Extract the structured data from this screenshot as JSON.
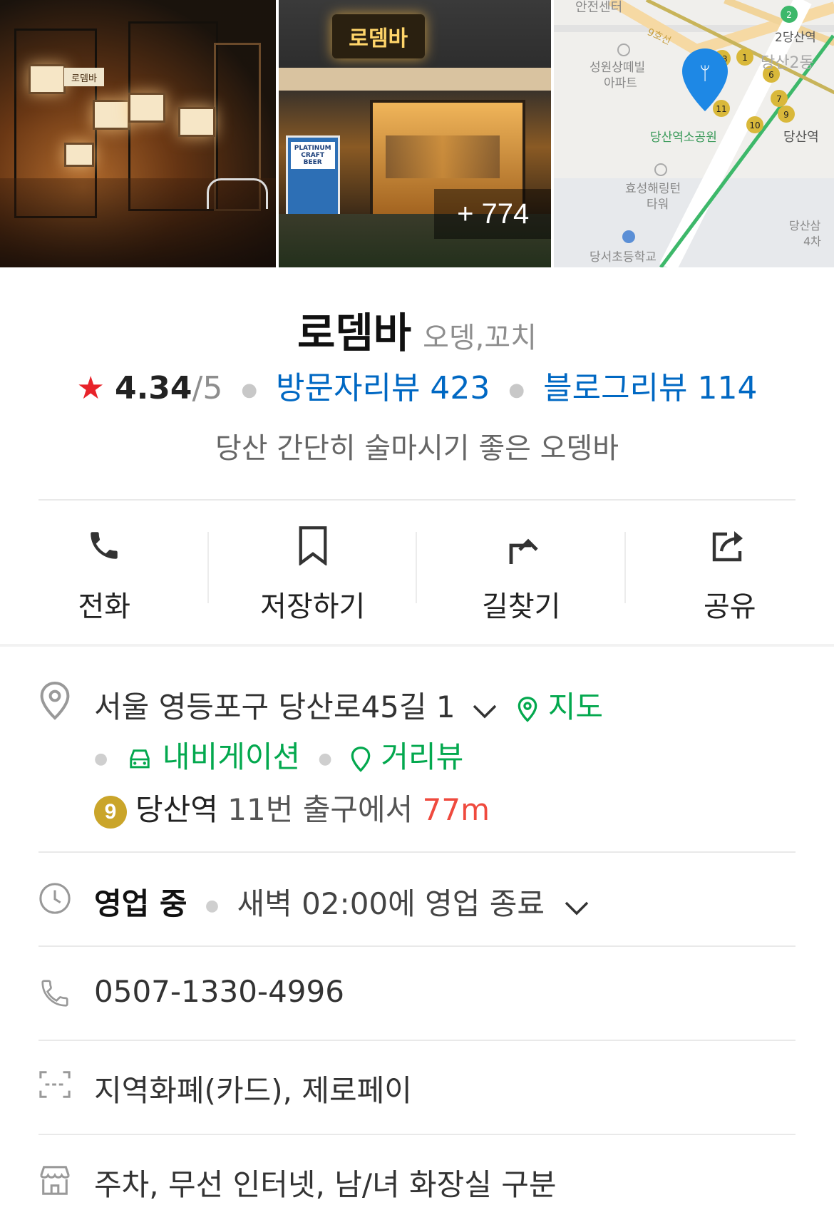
{
  "photos": {
    "photo1_sign": "로뎀바",
    "photo2_sign": "로뎀바",
    "photo2_banner": "PLATINUM CRAFT BEER",
    "more_count": "+ 774",
    "map": {
      "labels": {
        "safety_center": "안전센터",
        "line": "9호선",
        "apartment": "성원상떼빌\n아파트",
        "station_a": "2당산역",
        "dong": "당산2동",
        "station_b": "당산역",
        "park": "당산역소공원",
        "tower": "효성해링턴\n타워",
        "school": "당서초등학교",
        "road": "당산삼\n4차"
      }
    }
  },
  "place": {
    "name": "로뎀바",
    "category": "오뎅,꼬치",
    "rating": "4.34",
    "rating_max": "/5",
    "visitor_reviews": "방문자리뷰 423",
    "blog_reviews": "블로그리뷰 114",
    "description": "당산 간단히 술마시기 좋은 오뎅바"
  },
  "actions": [
    {
      "label": "전화",
      "icon": "phone-icon"
    },
    {
      "label": "저장하기",
      "icon": "bookmark-icon"
    },
    {
      "label": "길찾기",
      "icon": "directions-icon"
    },
    {
      "label": "공유",
      "icon": "share-icon"
    }
  ],
  "address": {
    "text": "서울 영등포구 당산로45길 1",
    "map_link": "지도",
    "navigation": "내비게이션",
    "street_view": "거리뷰",
    "line_number": "9",
    "station": "당산역",
    "exit_text": "11번 출구에서",
    "distance": "77m"
  },
  "hours": {
    "status": "영업 중",
    "detail": "새벽 02:00에 영업 종료"
  },
  "phone": "0507-1330-4996",
  "payment": "지역화폐(카드), 제로페이",
  "facilities": "주차, 무선 인터넷, 남/녀 화장실 구분",
  "colors": {
    "accent_blue": "#0068c3",
    "accent_green": "#03a84e",
    "star_red": "#e8232a",
    "distance_red": "#ef4a3e",
    "line9_gold": "#caa52a"
  }
}
